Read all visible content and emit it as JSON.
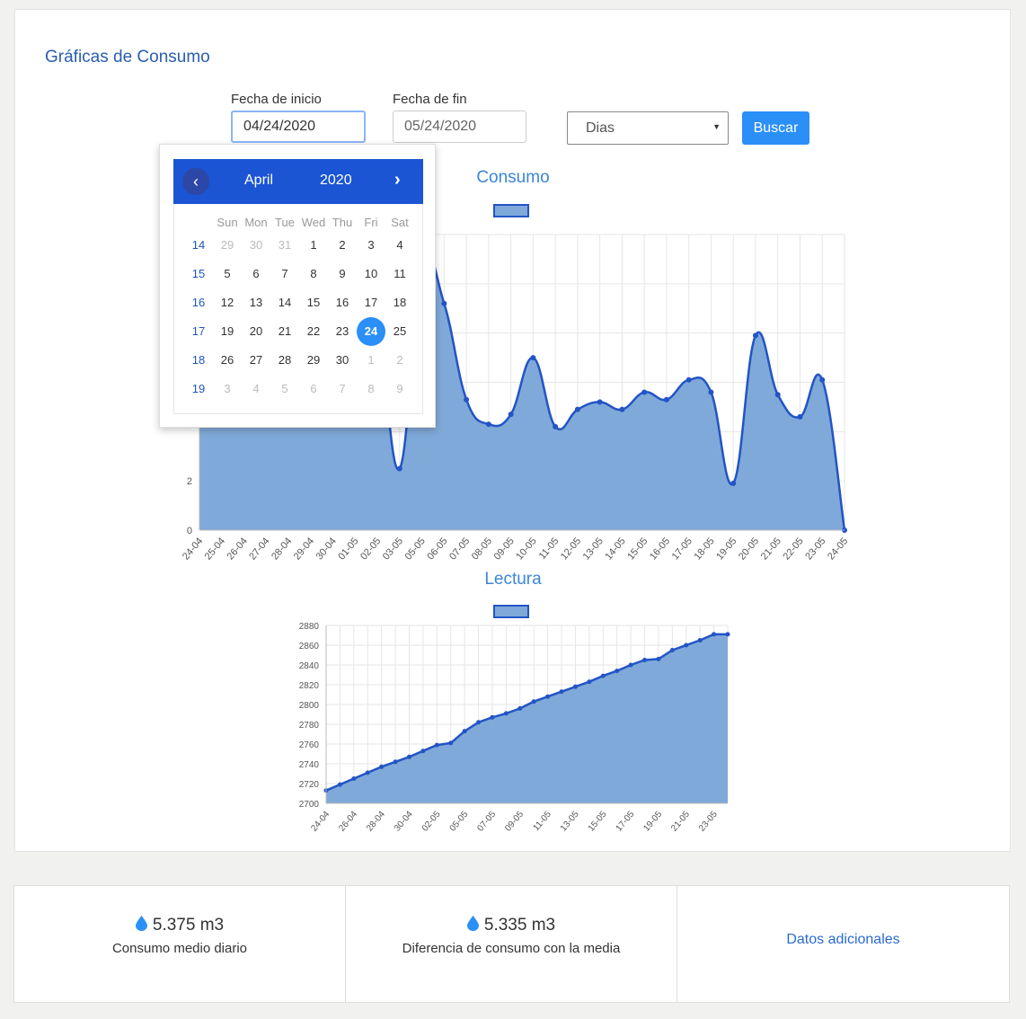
{
  "header": {
    "title": "Gráficas de Consumo"
  },
  "filters": {
    "start_label": "Fecha de inicio",
    "start_value": "04/24/2020",
    "end_label": "Fecha de fin",
    "end_value": "05/24/2020",
    "period_value": "Dias",
    "search_label": "Buscar"
  },
  "datepicker": {
    "month": "April",
    "year": "2020",
    "prev": "‹",
    "next": "›",
    "weekdays": [
      "Sun",
      "Mon",
      "Tue",
      "Wed",
      "Thu",
      "Fri",
      "Sat"
    ],
    "selected_day": "24",
    "weeks": [
      {
        "num": "14",
        "days": [
          [
            "29",
            true
          ],
          [
            "30",
            true
          ],
          [
            "31",
            true
          ],
          [
            "1",
            false
          ],
          [
            "2",
            false
          ],
          [
            "3",
            false
          ],
          [
            "4",
            false
          ]
        ]
      },
      {
        "num": "15",
        "days": [
          [
            "5",
            false
          ],
          [
            "6",
            false
          ],
          [
            "7",
            false
          ],
          [
            "8",
            false
          ],
          [
            "9",
            false
          ],
          [
            "10",
            false
          ],
          [
            "11",
            false
          ]
        ]
      },
      {
        "num": "16",
        "days": [
          [
            "12",
            false
          ],
          [
            "13",
            false
          ],
          [
            "14",
            false
          ],
          [
            "15",
            false
          ],
          [
            "16",
            false
          ],
          [
            "17",
            false
          ],
          [
            "18",
            false
          ]
        ]
      },
      {
        "num": "17",
        "days": [
          [
            "19",
            false
          ],
          [
            "20",
            false
          ],
          [
            "21",
            false
          ],
          [
            "22",
            false
          ],
          [
            "23",
            false
          ],
          [
            "24",
            false
          ],
          [
            "25",
            false
          ]
        ]
      },
      {
        "num": "18",
        "days": [
          [
            "26",
            false
          ],
          [
            "27",
            false
          ],
          [
            "28",
            false
          ],
          [
            "29",
            false
          ],
          [
            "30",
            false
          ],
          [
            "1",
            true
          ],
          [
            "2",
            true
          ]
        ]
      },
      {
        "num": "19",
        "days": [
          [
            "3",
            true
          ],
          [
            "4",
            true
          ],
          [
            "5",
            true
          ],
          [
            "6",
            true
          ],
          [
            "7",
            true
          ],
          [
            "8",
            true
          ],
          [
            "9",
            true
          ]
        ]
      }
    ]
  },
  "colors": {
    "accent": "#2a8ff7",
    "header_blue": "#1b55d4",
    "series_line": "#2354c6",
    "series_fill": "#7fa9d8"
  },
  "chart_data": [
    {
      "type": "area",
      "title": "Consumo",
      "categories": [
        "24-04",
        "25-04",
        "26-04",
        "27-04",
        "28-04",
        "29-04",
        "30-04",
        "01-05",
        "02-05",
        "03-05",
        "05-05",
        "06-05",
        "07-05",
        "08-05",
        "09-05",
        "10-05",
        "11-05",
        "12-05",
        "13-05",
        "14-05",
        "15-05",
        "16-05",
        "17-05",
        "18-05",
        "19-05",
        "20-05",
        "21-05",
        "22-05",
        "23-05",
        "24-05"
      ],
      "series": [
        {
          "values": [
            8.5,
            8.6,
            8.7,
            8.7,
            8.6,
            8.5,
            8.4,
            8.3,
            8.2,
            2.5,
            10.8,
            9.2,
            5.3,
            4.3,
            4.7,
            7.0,
            4.2,
            4.9,
            5.2,
            4.9,
            5.6,
            5.3,
            6.1,
            5.6,
            1.9,
            7.9,
            5.5,
            4.6,
            6.1,
            0.0
          ]
        }
      ],
      "y_ticks": [
        0,
        2
      ],
      "ylim": [
        0,
        12
      ],
      "grid": true,
      "curve": "smooth"
    },
    {
      "type": "area",
      "title": "Lectura",
      "categories": [
        "24-04",
        "25-04",
        "26-04",
        "27-04",
        "28-04",
        "29-04",
        "30-04",
        "01-05",
        "02-05",
        "03-05",
        "05-05",
        "06-05",
        "07-05",
        "08-05",
        "09-05",
        "10-05",
        "11-05",
        "12-05",
        "13-05",
        "14-05",
        "15-05",
        "16-05",
        "17-05",
        "18-05",
        "19-05",
        "20-05",
        "21-05",
        "22-05",
        "23-05",
        "24-05"
      ],
      "x_tick_labels": [
        "24-04",
        "26-04",
        "28-04",
        "30-04",
        "02-05",
        "05-05",
        "07-05",
        "09-05",
        "11-05",
        "13-05",
        "15-05",
        "17-05",
        "19-05",
        "21-05",
        "23-05"
      ],
      "series": [
        {
          "values": [
            2713,
            2719,
            2725,
            2731,
            2737,
            2742,
            2747,
            2753,
            2759,
            2761,
            2773,
            2782,
            2787,
            2791,
            2796,
            2803,
            2808,
            2813,
            2818,
            2823,
            2829,
            2834,
            2840,
            2845,
            2846,
            2855,
            2860,
            2865,
            2871,
            2871
          ]
        }
      ],
      "y_ticks": [
        2700,
        2720,
        2740,
        2760,
        2780,
        2800,
        2820,
        2840,
        2860,
        2880
      ],
      "ylim": [
        2700,
        2880
      ],
      "grid": true,
      "curve": "linear"
    }
  ],
  "stats": [
    {
      "value": "5.375 m3",
      "label": "Consumo medio diario",
      "icon": "water-drop-icon"
    },
    {
      "value": "5.335 m3",
      "label": "Diferencia de consumo con la media",
      "icon": "water-drop-icon"
    }
  ],
  "extra_link": "Datos adicionales"
}
